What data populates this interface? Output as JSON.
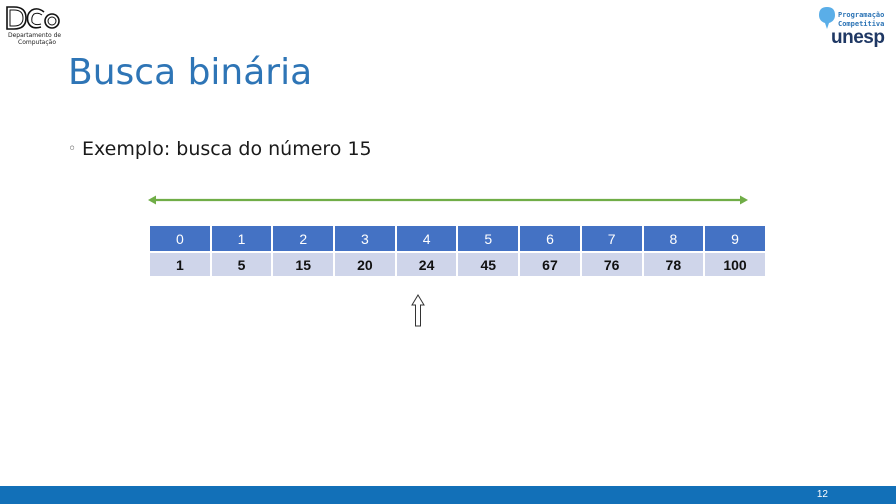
{
  "logo_dco": {
    "mark": "DCo",
    "line1": "Departamento de",
    "line2": "Computação"
  },
  "logo_unesp": {
    "line1": "Programação",
    "line2": "Competitiva",
    "name": "unesp",
    "colors": {
      "text": "#2e75b6",
      "name": "#1f3864",
      "bubble": "#5aaee8"
    }
  },
  "slide": {
    "title": "Busca binária",
    "bullet": "Exemplo: busca do número 15",
    "page_number": "12"
  },
  "array": {
    "indices": [
      "0",
      "1",
      "2",
      "3",
      "4",
      "5",
      "6",
      "7",
      "8",
      "9"
    ],
    "values": [
      "1",
      "5",
      "15",
      "20",
      "24",
      "45",
      "67",
      "76",
      "78",
      "100"
    ],
    "pointer_index": 4,
    "colors": {
      "header": "#4472c4",
      "row": "#cfd5ea",
      "range_arrow": "#70ad47",
      "footer": "#1270b8"
    }
  }
}
